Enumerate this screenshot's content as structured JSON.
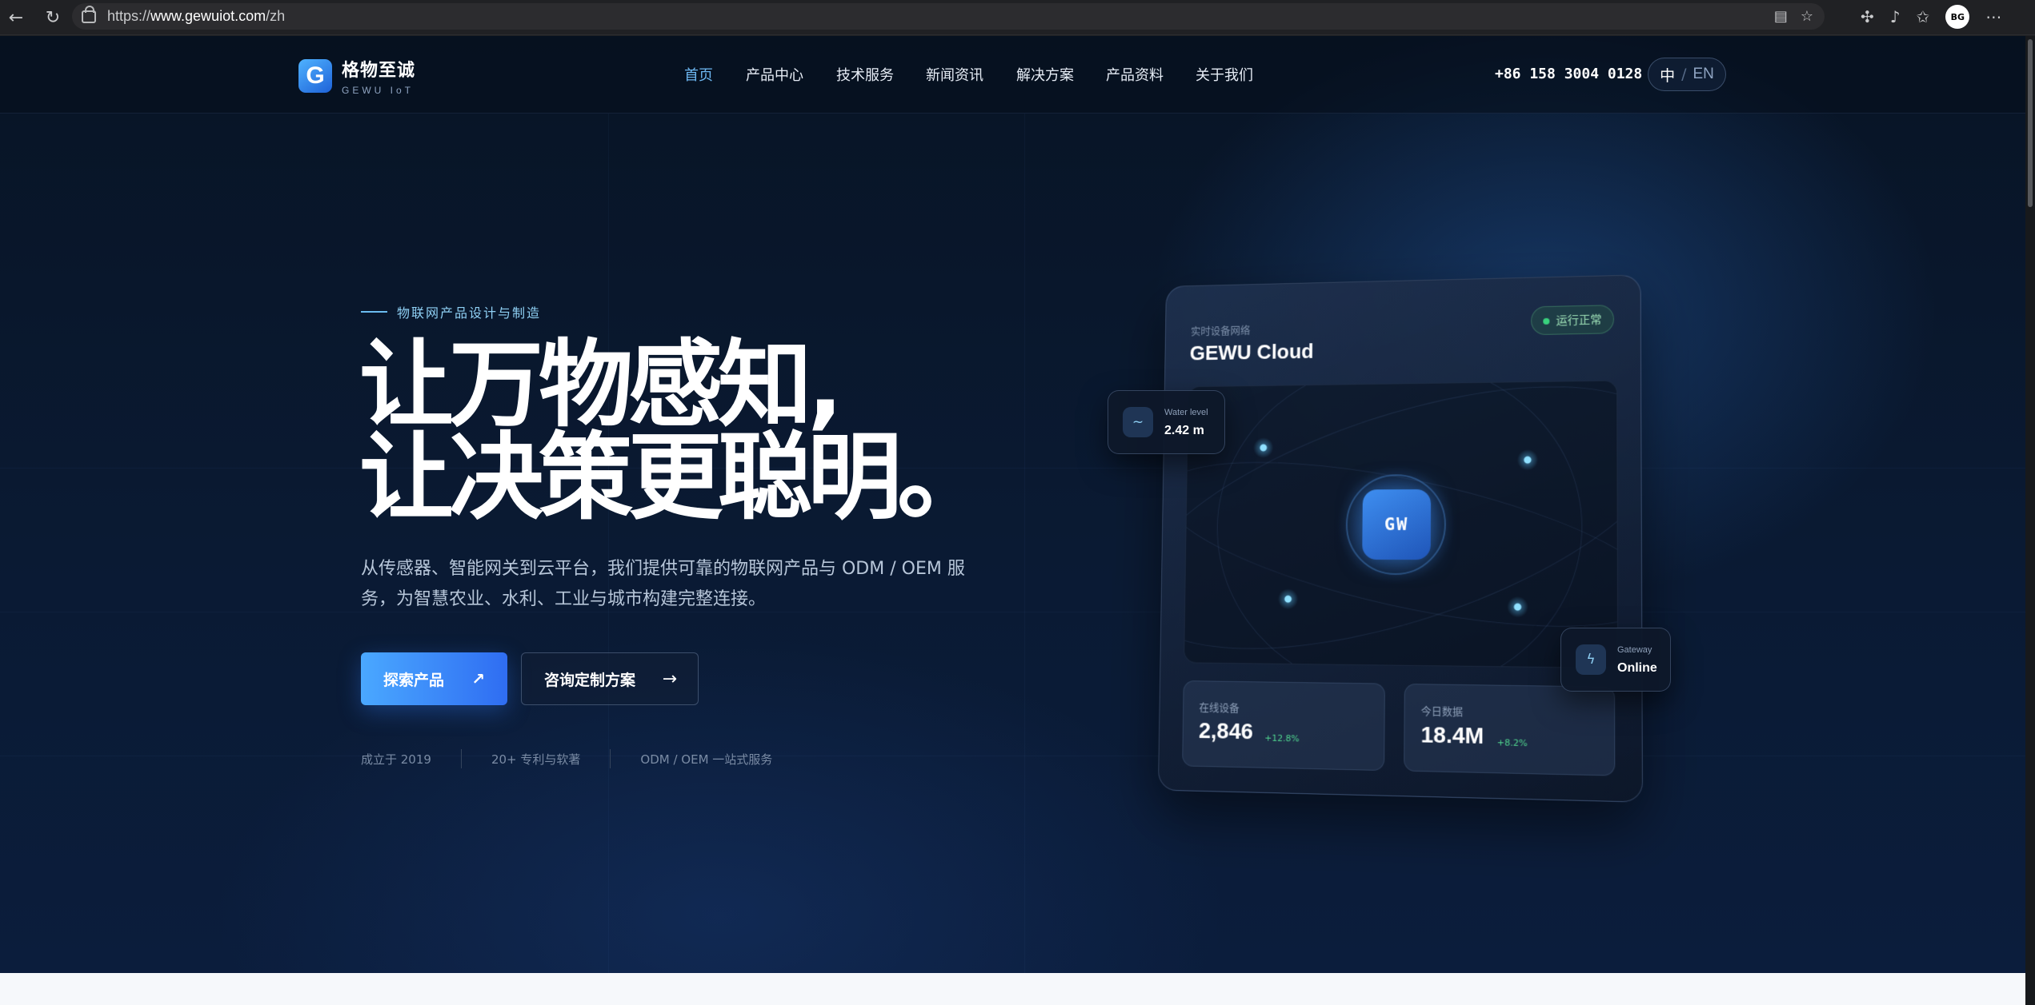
{
  "browser": {
    "url_prefix": "https://",
    "url_host": "www.gewuiot.com",
    "url_path": "/zh",
    "profile_initials": "BG"
  },
  "site": {
    "logo_letter": "G",
    "name": "格物至诚",
    "tagline": "GEWU IoT",
    "nav": [
      {
        "label": "首页",
        "active": true
      },
      {
        "label": "产品中心",
        "active": false
      },
      {
        "label": "技术服务",
        "active": false
      },
      {
        "label": "新闻资讯",
        "active": false
      },
      {
        "label": "解决方案",
        "active": false
      },
      {
        "label": "产品资料",
        "active": false
      },
      {
        "label": "关于我们",
        "active": false
      }
    ],
    "phone": "+86 158 3004 0128",
    "lang_current": "中",
    "lang_sep": "/",
    "lang_other": "EN"
  },
  "hero": {
    "kicker": "物联网产品设计与制造",
    "headline_line1": "让万物感知,",
    "headline_line2": "让决策更聪明。",
    "lead": "从传感器、智能网关到云平台，我们提供可靠的物联网产品与 ODM / OEM 服务，为智慧农业、水利、工业与城市构建完整连接。",
    "primary_cta": "探索产品",
    "primary_cta_icon": "↗",
    "secondary_cta": "咨询定制方案",
    "secondary_cta_icon": "→",
    "stats": [
      "成立于 2019",
      "20+ 专利与软著",
      "ODM / OEM 一站式服务"
    ]
  },
  "dashboard": {
    "label": "实时设备网络",
    "title": "GEWU Cloud",
    "status": "运行正常",
    "gateway_label": "GW",
    "metrics": [
      {
        "label": "在线设备",
        "value": "2,846",
        "delta": "+12.8%"
      },
      {
        "label": "今日数据",
        "value": "18.4M",
        "delta": "+8.2%"
      }
    ],
    "water": {
      "icon": "wave-icon",
      "label": "Water level",
      "value": "2.42 m"
    },
    "gateway": {
      "icon": "bolt-icon",
      "label": "Gateway",
      "value": "Online"
    }
  },
  "colors": {
    "accent": "#4aa8ff",
    "nav_active": "#6db8f2",
    "status_ok": "#39d27d",
    "delta_up": "#4fd48e",
    "background": "#081425"
  }
}
